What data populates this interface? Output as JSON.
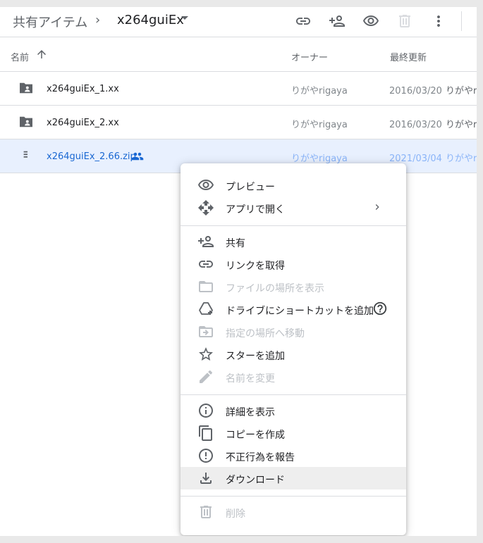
{
  "header": {
    "breadcrumb_root": "共有アイテム",
    "breadcrumb_separator": "›",
    "breadcrumb_current": "x264guiEx"
  },
  "columns": {
    "name": "名前",
    "owner": "オーナー",
    "modified": "最終更新"
  },
  "files": [
    {
      "name": "x264guiEx_1.xx",
      "owner": "りがやrigaya",
      "modified": "2016/03/20",
      "modified_by": "りがやri..",
      "icon": "shared-folder-icon"
    },
    {
      "name": "x264guiEx_2.xx",
      "owner": "りがやrigaya",
      "modified": "2016/03/20",
      "modified_by": "りがやri..",
      "icon": "shared-folder-icon"
    },
    {
      "name": "x264guiEx_2.66.zip",
      "owner": "りがやrigaya",
      "modified": "2021/03/04",
      "modified_by": "りがやri..",
      "icon": "zip-file-icon",
      "selected": true
    }
  ],
  "menu": {
    "preview": "プレビュー",
    "open_with": "アプリで開く",
    "share": "共有",
    "get_link": "リンクを取得",
    "show_location": "ファイルの場所を表示",
    "add_shortcut": "ドライブにショートカットを追加",
    "move_to": "指定の場所へ移動",
    "add_star": "スターを追加",
    "rename": "名前を変更",
    "details": "詳細を表示",
    "copy": "コピーを作成",
    "report": "不正行為を報告",
    "download": "ダウンロード",
    "delete": "削除"
  },
  "colors": {
    "accent": "#1967d2",
    "selected_row": "#e8f0fe",
    "icon_gray": "#5f6368",
    "disabled": "#bdc1c6"
  }
}
